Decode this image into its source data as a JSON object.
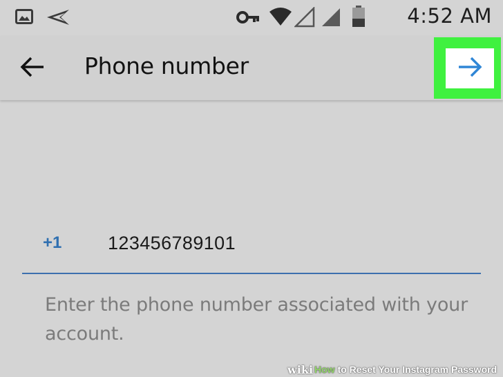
{
  "statusbar": {
    "time": "4:52 AM",
    "icons": [
      "image-icon",
      "send-icon",
      "key-icon",
      "wifi-icon",
      "signal-icon",
      "signal-icon",
      "battery-icon"
    ]
  },
  "appbar": {
    "title": "Phone number",
    "back_icon": "arrow-left-icon",
    "next_icon": "arrow-right-icon"
  },
  "phone": {
    "country_code": "+1",
    "value": "123456789101"
  },
  "helper_text": "Enter the phone number associated with your account.",
  "watermark": {
    "brand": "wiki",
    "how": "How",
    "rest": "to Reset Your Instagram Password"
  },
  "colors": {
    "background": "#d4d4d4",
    "accent_blue": "#2f6fb0",
    "highlight_green": "#3ff13f",
    "helper_gray": "#7b7b7b"
  }
}
